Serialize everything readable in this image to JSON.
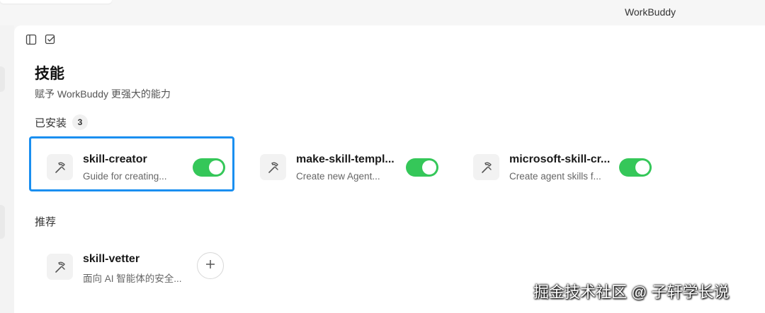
{
  "window": {
    "app_title": "WorkBuddy"
  },
  "toolbar": [
    {
      "name": "sidebar-toggle-icon"
    },
    {
      "name": "checklist-icon"
    }
  ],
  "page": {
    "title": "技能",
    "subtitle": "赋予 WorkBuddy 更强大的能力"
  },
  "installed": {
    "heading": "已安装",
    "count": "3",
    "skills": [
      {
        "name": "skill-creator",
        "description": "Guide for creating...",
        "enabled": true,
        "icon": "hammer-pick-icon"
      },
      {
        "name": "make-skill-templ...",
        "description": "Create new Agent...",
        "enabled": true,
        "icon": "hammer-pick-icon"
      },
      {
        "name": "microsoft-skill-cr...",
        "description": "Create agent skills f...",
        "enabled": true,
        "icon": "hammer-pick-icon"
      }
    ]
  },
  "recommended": {
    "heading": "推荐",
    "skills": [
      {
        "name": "skill-vetter",
        "description": "面向 AI 智能体的安全...",
        "icon": "hammer-pick-icon",
        "action": "plus-icon"
      }
    ]
  },
  "watermark": "掘金技术社区 @ 子轩学长说",
  "colors": {
    "toggle_on": "#35c759",
    "selection": "#1a8ff0"
  }
}
